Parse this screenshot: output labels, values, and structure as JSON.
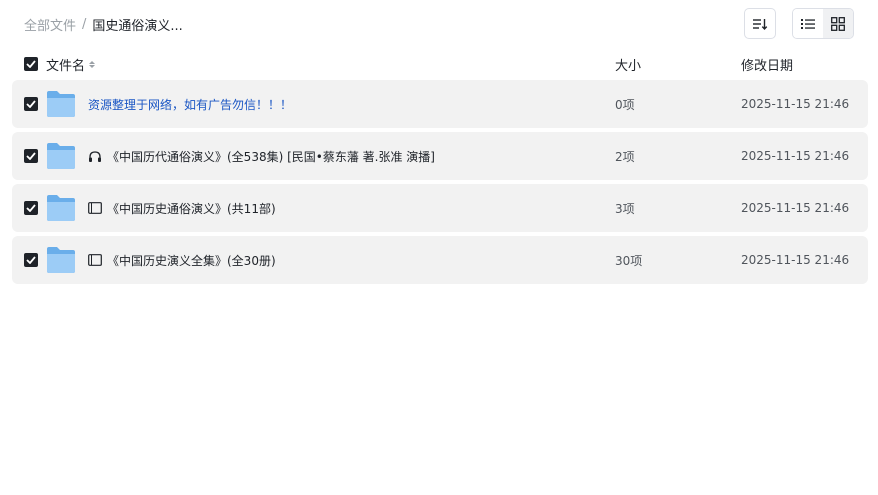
{
  "breadcrumb": {
    "root": "全部文件",
    "separator": "/",
    "current": "国史通俗演义..."
  },
  "toolbar": {
    "sort_icon": "sort-icon",
    "list_view_icon": "list-view-icon",
    "grid_view_icon": "grid-view-icon"
  },
  "header": {
    "name": "文件名",
    "size": "大小",
    "date": "修改日期"
  },
  "rows": [
    {
      "name": "资源整理于网络，如有广告勿信！！！",
      "size": "0项",
      "date": "2025-11-15 21:46",
      "icon": ""
    },
    {
      "name": "《中国历代通俗演义》(全538集) [民国•蔡东藩 著.张准 演播]",
      "size": "2项",
      "date": "2025-11-15 21:46",
      "icon": "headphones-icon"
    },
    {
      "name": "《中国历史通俗演义》(共11部)",
      "size": "3项",
      "date": "2025-11-15 21:46",
      "icon": "book-icon"
    },
    {
      "name": "《中国历史演义全集》(全30册)",
      "size": "30项",
      "date": "2025-11-15 21:46",
      "icon": "book-icon"
    }
  ],
  "colors": {
    "accent_link": "#1a56c4",
    "row_bg": "#f2f2f2",
    "checkbox": "#1f2329",
    "folder": "#7ab8f0"
  }
}
